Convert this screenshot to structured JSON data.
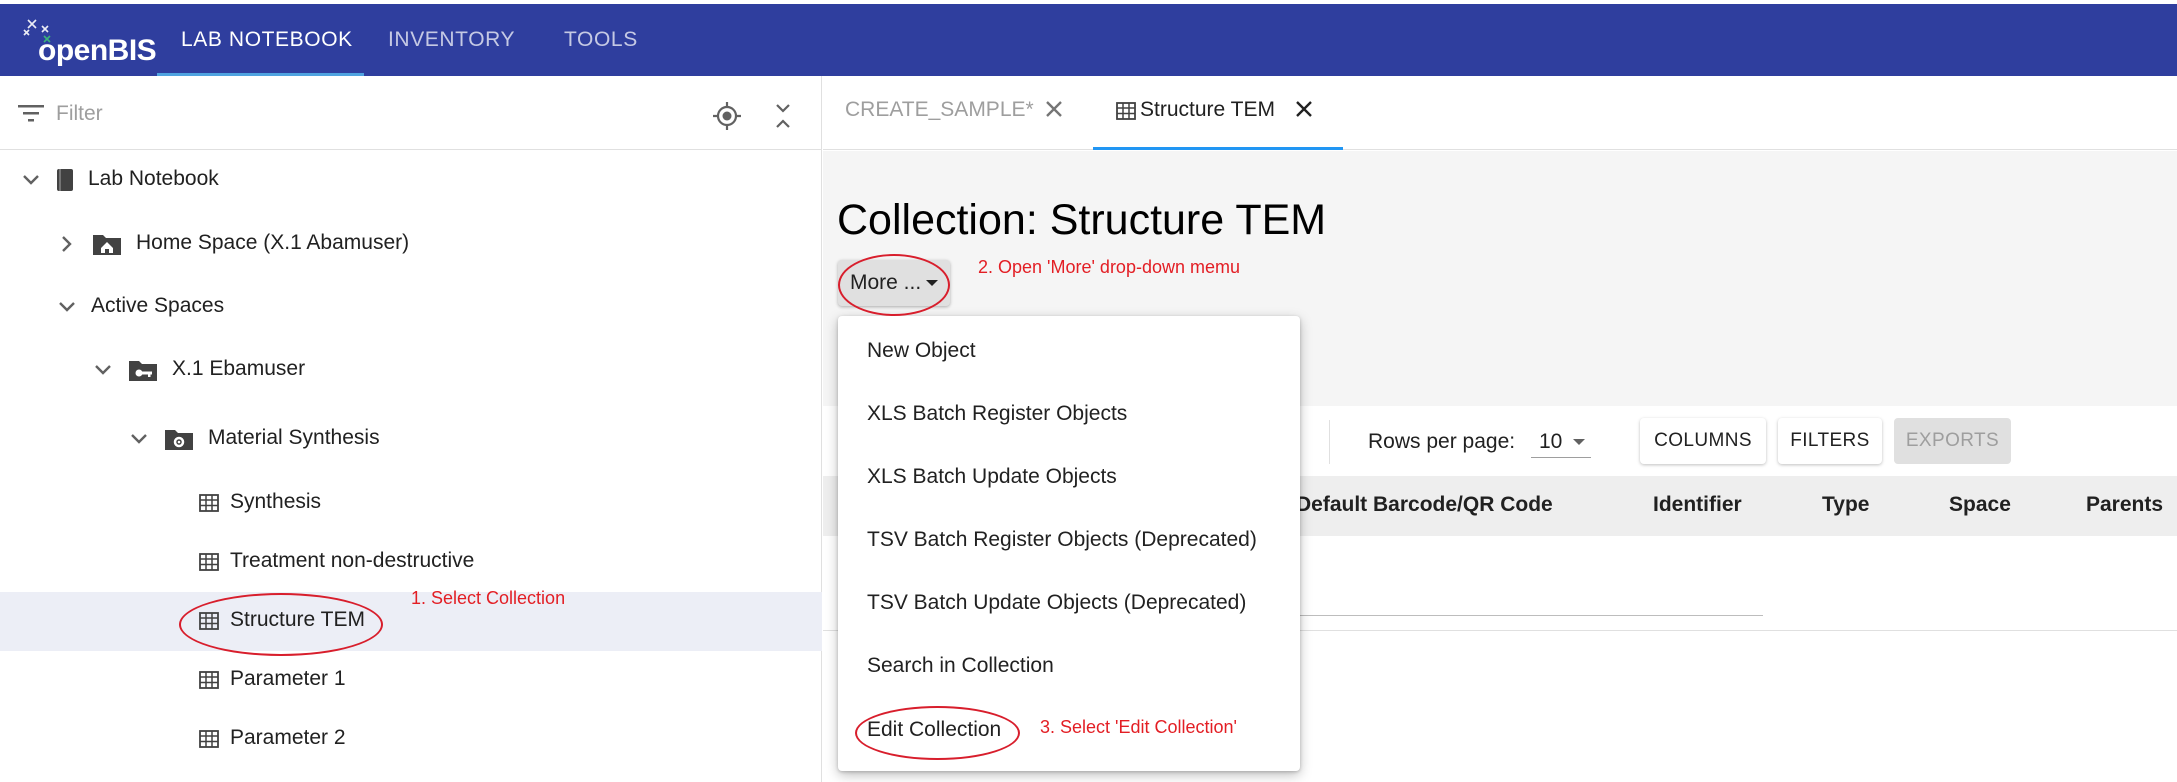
{
  "topbar": {
    "logo_text": "openBIS",
    "tabs": [
      {
        "label": "LAB NOTEBOOK",
        "active": true
      },
      {
        "label": "INVENTORY",
        "active": false
      },
      {
        "label": "TOOLS",
        "active": false
      }
    ],
    "bg_color": "#2f3e9e"
  },
  "sidebar": {
    "filter_placeholder": "Filter",
    "tree": [
      {
        "label": "Lab Notebook",
        "icon": "notebook-icon",
        "expanded": true
      },
      {
        "label": "Home Space (X.1 Abamuser)",
        "icon": "home-folder-icon",
        "expanded": false
      },
      {
        "label": "Active Spaces",
        "icon": "",
        "expanded": true
      },
      {
        "label": "X.1 Ebamuser",
        "icon": "key-folder-icon",
        "expanded": true
      },
      {
        "label": "Material Synthesis",
        "icon": "gear-folder-icon",
        "expanded": true
      },
      {
        "label": "Synthesis",
        "icon": "table-icon"
      },
      {
        "label": "Treatment non-destructive",
        "icon": "table-icon"
      },
      {
        "label": "Structure TEM",
        "icon": "table-icon",
        "selected": true
      },
      {
        "label": "Parameter 1",
        "icon": "table-icon"
      },
      {
        "label": "Parameter 2",
        "icon": "table-icon"
      }
    ]
  },
  "main": {
    "tabs": [
      {
        "label": "CREATE_SAMPLE*",
        "active": false
      },
      {
        "label": "Structure TEM",
        "active": true
      }
    ],
    "page_title": "Collection: Structure TEM",
    "more_button": "More ...",
    "rows_per_page_label": "Rows per page:",
    "rows_per_page_value": "10",
    "toolbar_buttons": {
      "columns": "COLUMNS",
      "filters": "FILTERS",
      "exports": "EXPORTS"
    },
    "columns": [
      "Default Barcode/QR Code",
      "Identifier",
      "Type",
      "Space",
      "Parents"
    ]
  },
  "dropdown": {
    "items": [
      "New Object",
      "XLS Batch Register Objects",
      "XLS Batch Update Objects",
      "TSV Batch Register Objects (Deprecated)",
      "TSV Batch Update Objects (Deprecated)",
      "Search in Collection",
      "Edit Collection"
    ]
  },
  "annotations": {
    "step1": "1. Select Collection",
    "step2": "2. Open 'More' drop-down memu",
    "step3": "3. Select 'Edit Collection'",
    "color": "#e31e24"
  }
}
